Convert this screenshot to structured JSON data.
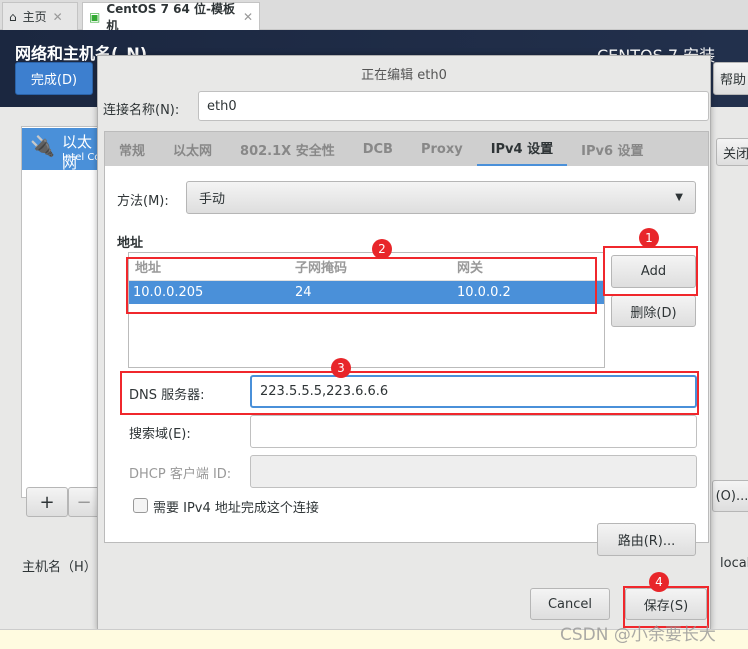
{
  "browser_tabs": [
    {
      "label": "主页",
      "icon": "home-icon"
    },
    {
      "label": "CentOS 7 64 位-模板机",
      "icon": "vm-icon"
    }
  ],
  "header": {
    "title": "网络和主机名(_N)",
    "product": "CENTOS 7 安装",
    "done_label": "完成(D)",
    "help_label": "帮助"
  },
  "sidebar": {
    "items": [
      {
        "label": "以太网",
        "sub": "Intel Corporation"
      }
    ],
    "add": "+",
    "remove": "−"
  },
  "background": {
    "close_label": "关闭",
    "configure_label": "(O)...",
    "hostname_label": "主机名（H）",
    "hostname_value": "local"
  },
  "dialog": {
    "title": "正在编辑 eth0",
    "conn_name_label": "连接名称(N):",
    "conn_name_value": "eth0",
    "tabs": [
      "常规",
      "以太网",
      "802.1X 安全性",
      "DCB",
      "Proxy",
      "IPv4 设置",
      "IPv6 设置"
    ],
    "active_tab": "IPv4 设置",
    "method_label": "方法(M):",
    "method_value": "手动",
    "address_section": "地址",
    "columns": [
      "地址",
      "子网掩码",
      "网关"
    ],
    "rows": [
      {
        "address": "10.0.0.205",
        "netmask": "24",
        "gateway": "10.0.0.2"
      }
    ],
    "add_label": "Add",
    "delete_label": "删除(D)",
    "dns_label": "DNS 服务器:",
    "dns_value": "223.5.5.5,223.6.6.6",
    "search_label": "搜索域(E):",
    "search_value": "",
    "dhcp_label": "DHCP 客户端 ID:",
    "dhcp_value": "",
    "require_ipv4_label": "需要 IPv4 地址完成这个连接",
    "require_ipv4_checked": false,
    "routes_label": "路由(R)...",
    "cancel_label": "Cancel",
    "save_label": "保存(S)"
  },
  "annotations": [
    "1",
    "2",
    "3",
    "4"
  ],
  "watermark": "CSDN @小余要长大",
  "colors": {
    "accent": "#4a90d9",
    "annotation": "#f0272c",
    "header": "#1b2740"
  }
}
